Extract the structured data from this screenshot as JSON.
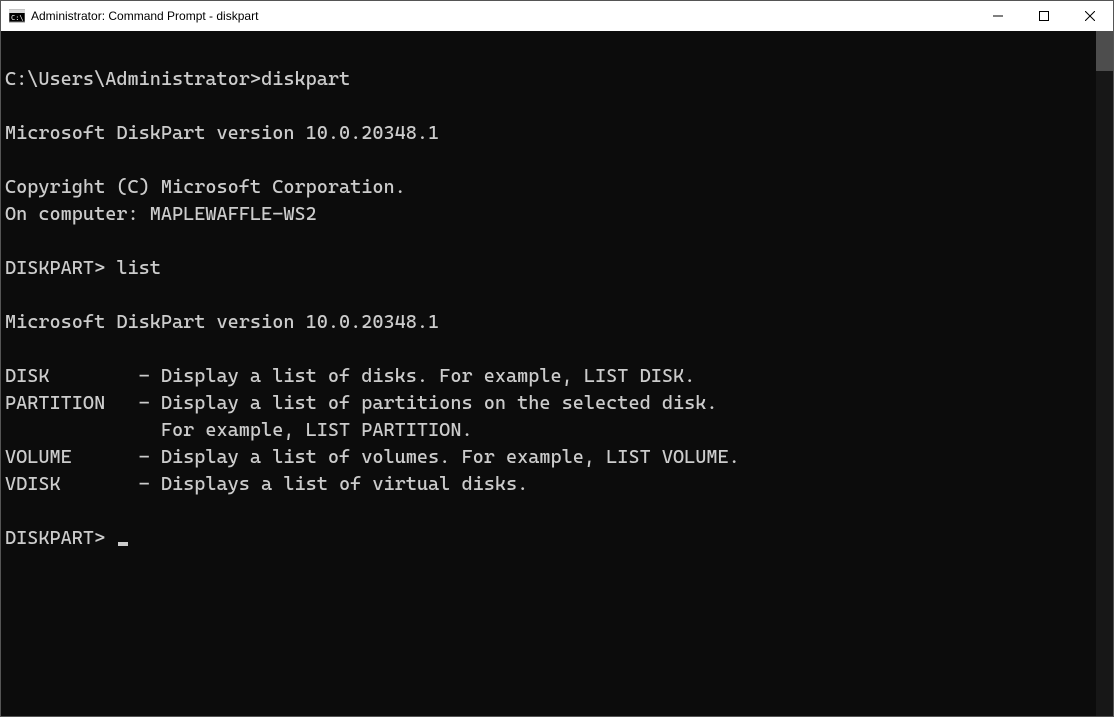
{
  "window": {
    "title": "Administrator: Command Prompt - diskpart"
  },
  "console": {
    "prompt1_path": "C:\\Users\\Administrator>",
    "prompt1_cmd": "diskpart",
    "version_line_1": "Microsoft DiskPart version 10.0.20348.1",
    "copyright_line": "Copyright (C) Microsoft Corporation.",
    "computer_line": "On computer: MAPLEWAFFLE-WS2",
    "dp_prompt_1": "DISKPART> ",
    "dp_cmd_1": "list",
    "version_line_2": "Microsoft DiskPart version 10.0.20348.1",
    "help_disk": "DISK        - Display a list of disks. For example, LIST DISK.",
    "help_partition": "PARTITION   - Display a list of partitions on the selected disk.",
    "help_partition2": "              For example, LIST PARTITION.",
    "help_volume": "VOLUME      - Display a list of volumes. For example, LIST VOLUME.",
    "help_vdisk": "VDISK       - Displays a list of virtual disks.",
    "dp_prompt_2": "DISKPART> "
  }
}
